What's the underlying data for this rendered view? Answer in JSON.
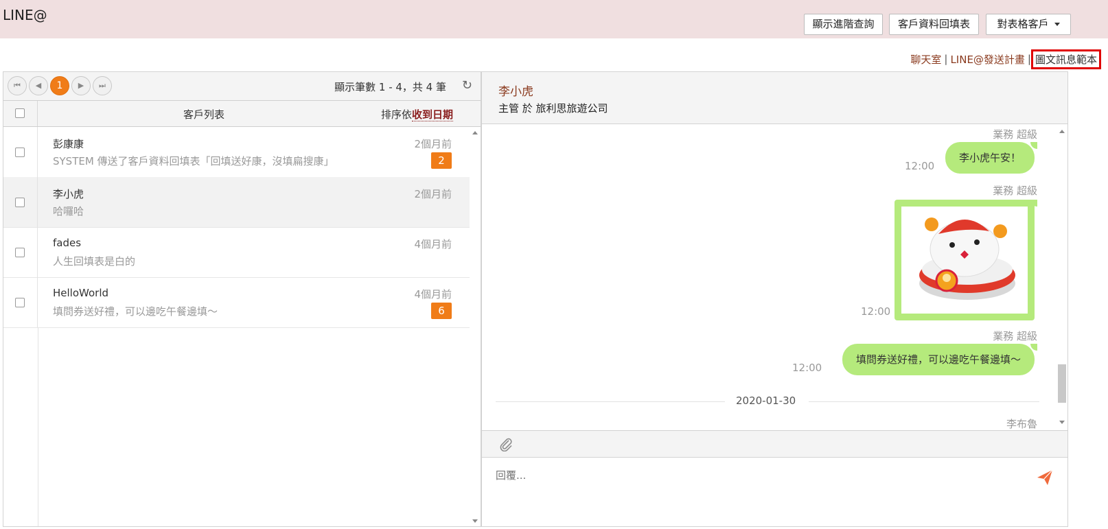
{
  "app": {
    "brand": "LINE@"
  },
  "topbar": {
    "advanced_query_label": "顯示進階查詢",
    "customer_form_label": "客戶資料回填表",
    "table_customer_label": "對表格客戶"
  },
  "toplinks": {
    "chatroom": "聊天室",
    "send_plan": "LINE@發送計畫",
    "template": "圖文訊息範本",
    "sep": "|"
  },
  "pager": {
    "first": "⏮",
    "prev": "◀",
    "current": "1",
    "next": "▶",
    "last": "⏭",
    "count_text": "顯示筆數 1 - 4，共 4 筆",
    "refresh": "↻"
  },
  "list": {
    "title": "客戶列表",
    "sort_prefix": "排序依",
    "sort_field": "收到日期",
    "rows": [
      {
        "name": "彭康康",
        "message": "SYSTEM 傳送了客戶資料回填表「回填送好康，沒填扁搜康」",
        "when": "2個月前",
        "badge": "2"
      },
      {
        "name": "李小虎",
        "message": "哈囉哈",
        "when": "2個月前",
        "badge": ""
      },
      {
        "name": "fades",
        "message": "人生回填表是白的",
        "when": "4個月前",
        "badge": ""
      },
      {
        "name": "HelloWorld",
        "message": "填問券送好禮，可以邊吃午餐邊填～",
        "when": "4個月前",
        "badge": "6"
      }
    ]
  },
  "chat": {
    "contact_name": "李小虎",
    "contact_sub": "主管 於 旅利思旅遊公司",
    "messages": [
      {
        "sender": "業務 超級",
        "text": "李小虎午安！",
        "time": "12:00"
      },
      {
        "sender": "業務 超級",
        "text": "",
        "time": "12:00"
      },
      {
        "sender": "業務 超級",
        "text": "填問券送好禮，可以邊吃午餐邊填～",
        "time": "12:00"
      }
    ],
    "date_separator": "2020-01-30",
    "next_sender": "李布魯",
    "reply_placeholder": "回覆..."
  },
  "colors": {
    "accent": "#f07c18",
    "bubble": "#b5ea7c",
    "header_bg": "#f0dfe0",
    "link": "#8a3a1e"
  }
}
